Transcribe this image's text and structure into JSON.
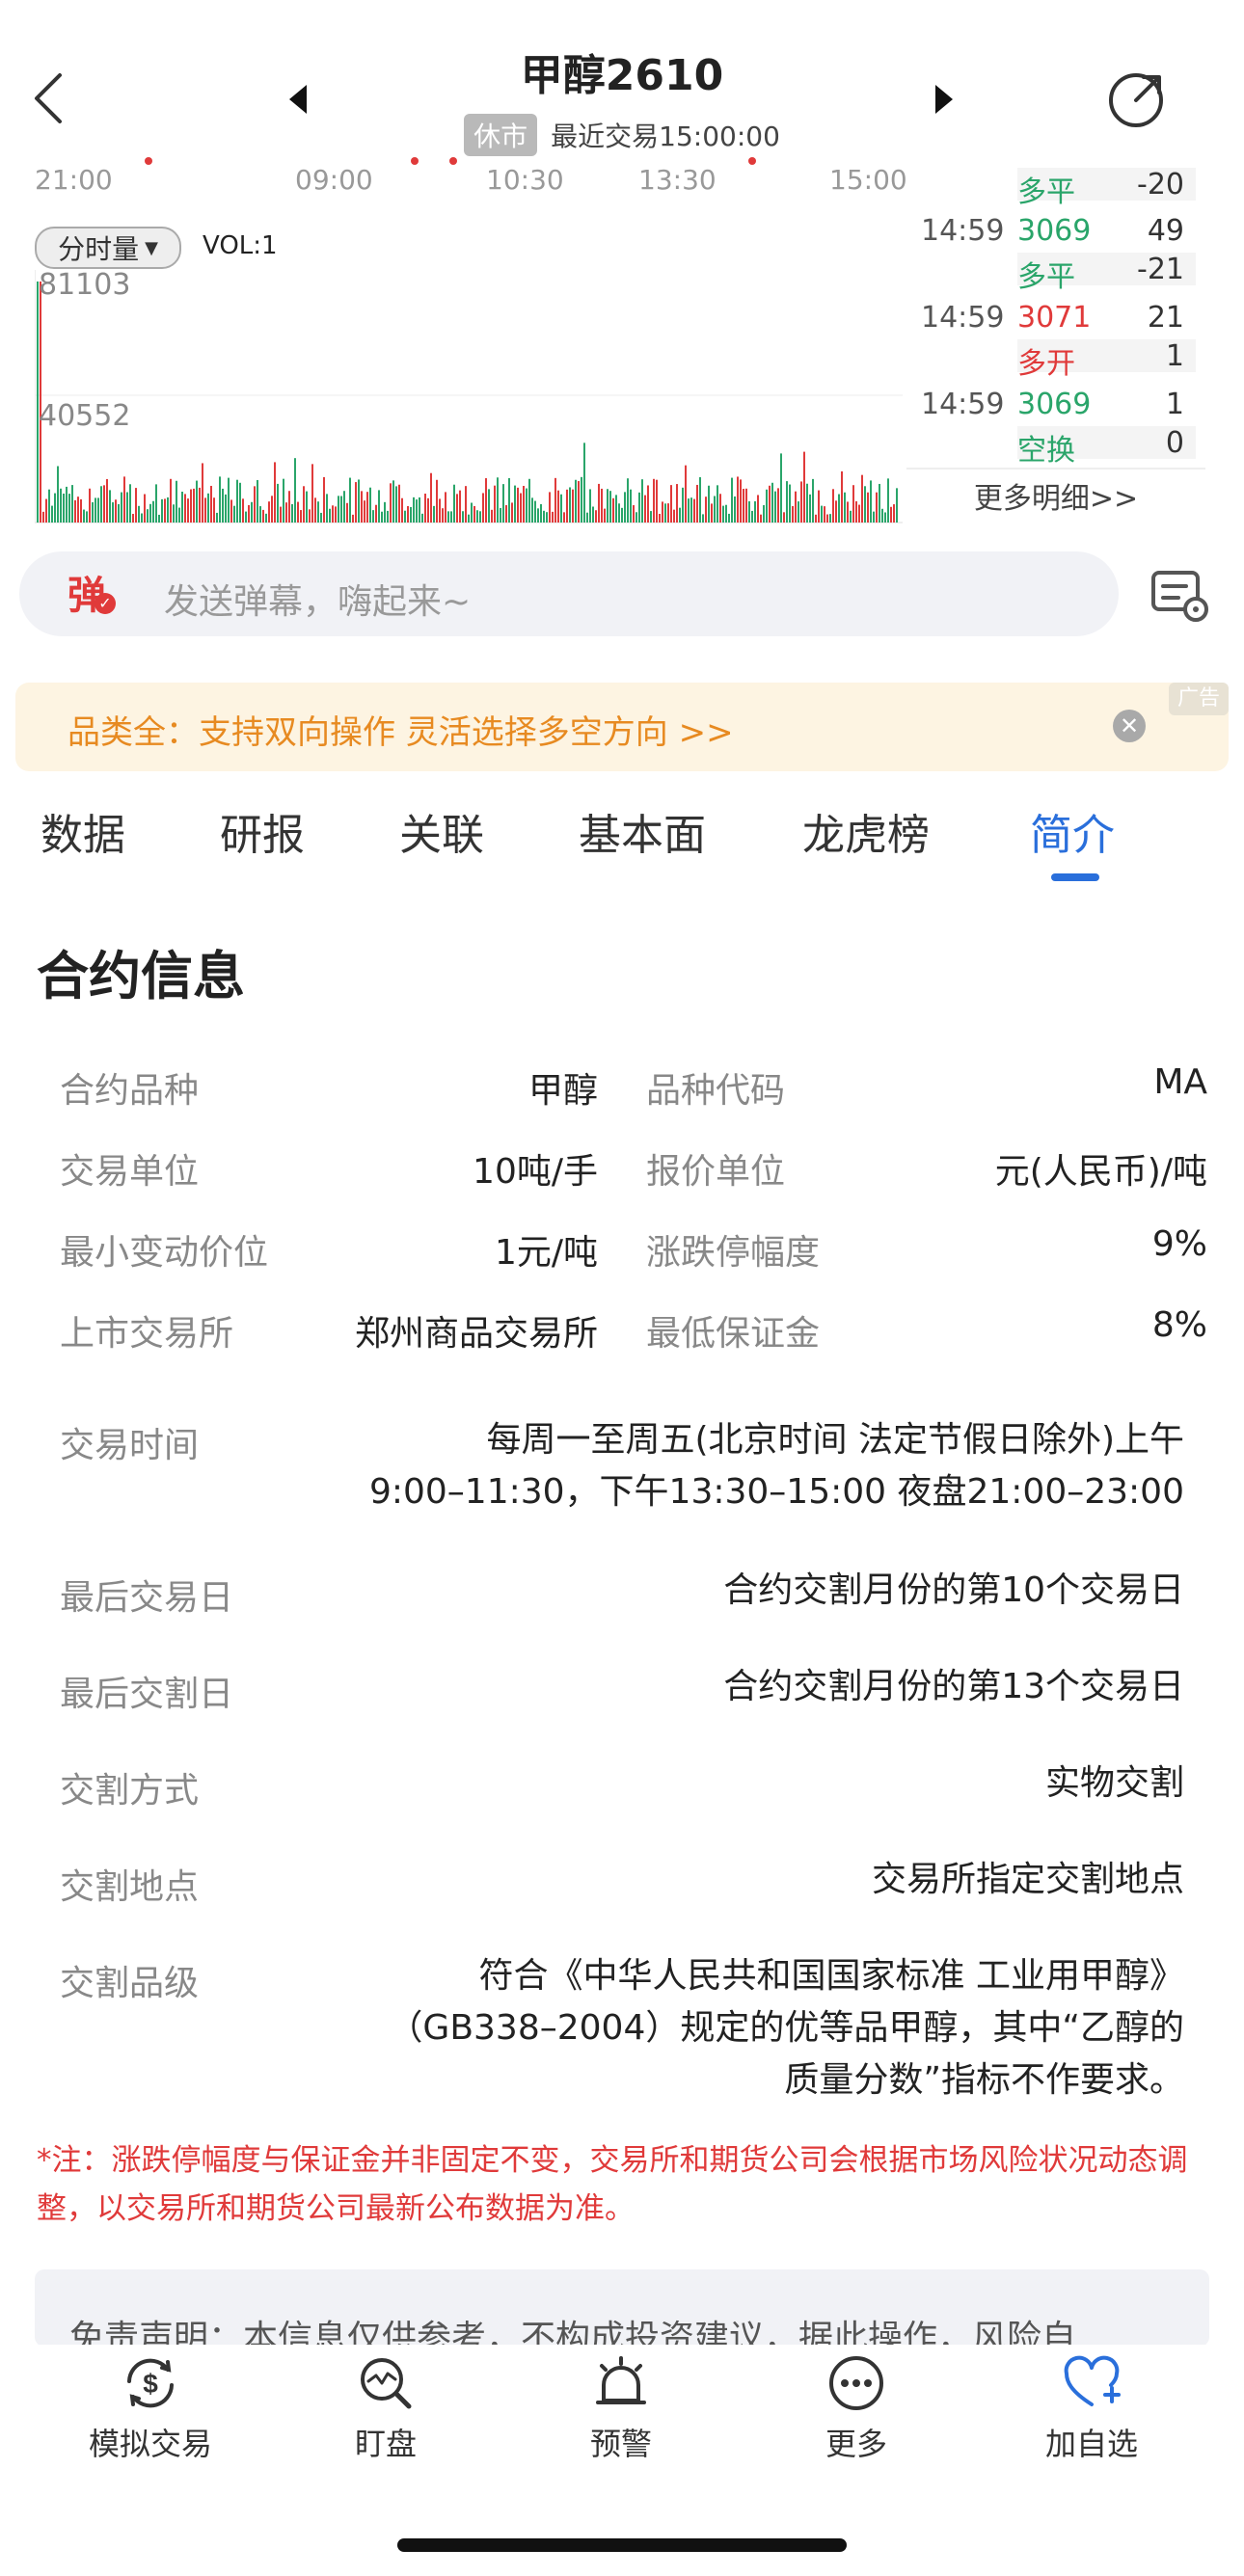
{
  "header": {
    "title": "甲醇2610",
    "status_badge": "休市",
    "last_trade": "最近交易15:00:00"
  },
  "chart": {
    "time_axis": [
      "21:00",
      "09:00",
      "10:30",
      "13:30",
      "15:00"
    ],
    "indicator_select": "分时量",
    "vol_label": "VOL:1",
    "vol_max": "81103",
    "vol_mid": "40552"
  },
  "ticks": [
    {
      "time": "",
      "price": "",
      "volume": "",
      "type": "多平",
      "type_val": "-20",
      "color": "#2aa56a"
    },
    {
      "time": "14:59",
      "price": "3069",
      "volume": "49",
      "type": "多平",
      "type_val": "-21",
      "color": "#2aa56a"
    },
    {
      "time": "14:59",
      "price": "3071",
      "volume": "21",
      "type": "多开",
      "type_val": "1",
      "color": "#e03a3a"
    },
    {
      "time": "14:59",
      "price": "3069",
      "volume": "1",
      "type": "空换",
      "type_val": "0",
      "color": "#2aa56a"
    }
  ],
  "more_detail": "更多明细>>",
  "danmaku": {
    "icon_char": "弹",
    "placeholder": "发送弹幕，嗨起来~"
  },
  "ad": {
    "text": "品类全：支持双向操作 灵活选择多空方向 >>",
    "tag": "广告"
  },
  "tabs": [
    "数据",
    "研报",
    "关联",
    "基本面",
    "龙虎榜",
    "简介"
  ],
  "active_tab": "简介",
  "section_title": "合约信息",
  "grid": [
    {
      "l1": "合约品种",
      "v1": "甲醇",
      "l2": "品种代码",
      "v2": "MA"
    },
    {
      "l1": "交易单位",
      "v1": "10吨/手",
      "l2": "报价单位",
      "v2": "元(人民币)/吨"
    },
    {
      "l1": "最小变动价位",
      "v1": "1元/吨",
      "l2": "涨跌停幅度",
      "v2": "9%"
    },
    {
      "l1": "上市交易所",
      "v1": "郑州商品交易所",
      "l2": "最低保证金",
      "v2": "8%"
    }
  ],
  "details": [
    {
      "label": "交易时间",
      "lines": [
        "每周一至周五(北京时间 法定节假日除外)上午",
        "9:00–11:30，下午13:30–15:00  夜盘21:00–23:00"
      ]
    },
    {
      "label": "最后交易日",
      "lines": [
        "合约交割月份的第10个交易日"
      ]
    },
    {
      "label": "最后交割日",
      "lines": [
        "合约交割月份的第13个交易日"
      ]
    },
    {
      "label": "交割方式",
      "lines": [
        "实物交割"
      ]
    },
    {
      "label": "交割地点",
      "lines": [
        "交易所指定交割地点"
      ]
    },
    {
      "label": "交割品级",
      "lines": [
        "符合《中华人民共和国国家标准 工业用甲醇》",
        "（GB338–2004）规定的优等品甲醇，其中“乙醇的",
        "质量分数”指标不作要求。"
      ]
    }
  ],
  "note": "*注：涨跌停幅度与保证金并非固定不变，交易所和期货公司会根据市场风险状况动态调整，以交易所和期货公司最新公布数据为准。",
  "disclaimer": "免责声明：本信息仅供参考，不构成投资建议，据此操作，风险自",
  "bottom_nav": [
    "模拟交易",
    "盯盘",
    "预警",
    "更多",
    "加自选"
  ],
  "colors": {
    "up": "#e03a3a",
    "down": "#2aa56a",
    "accent": "#2a6fdb",
    "ad": "#e78a21"
  }
}
